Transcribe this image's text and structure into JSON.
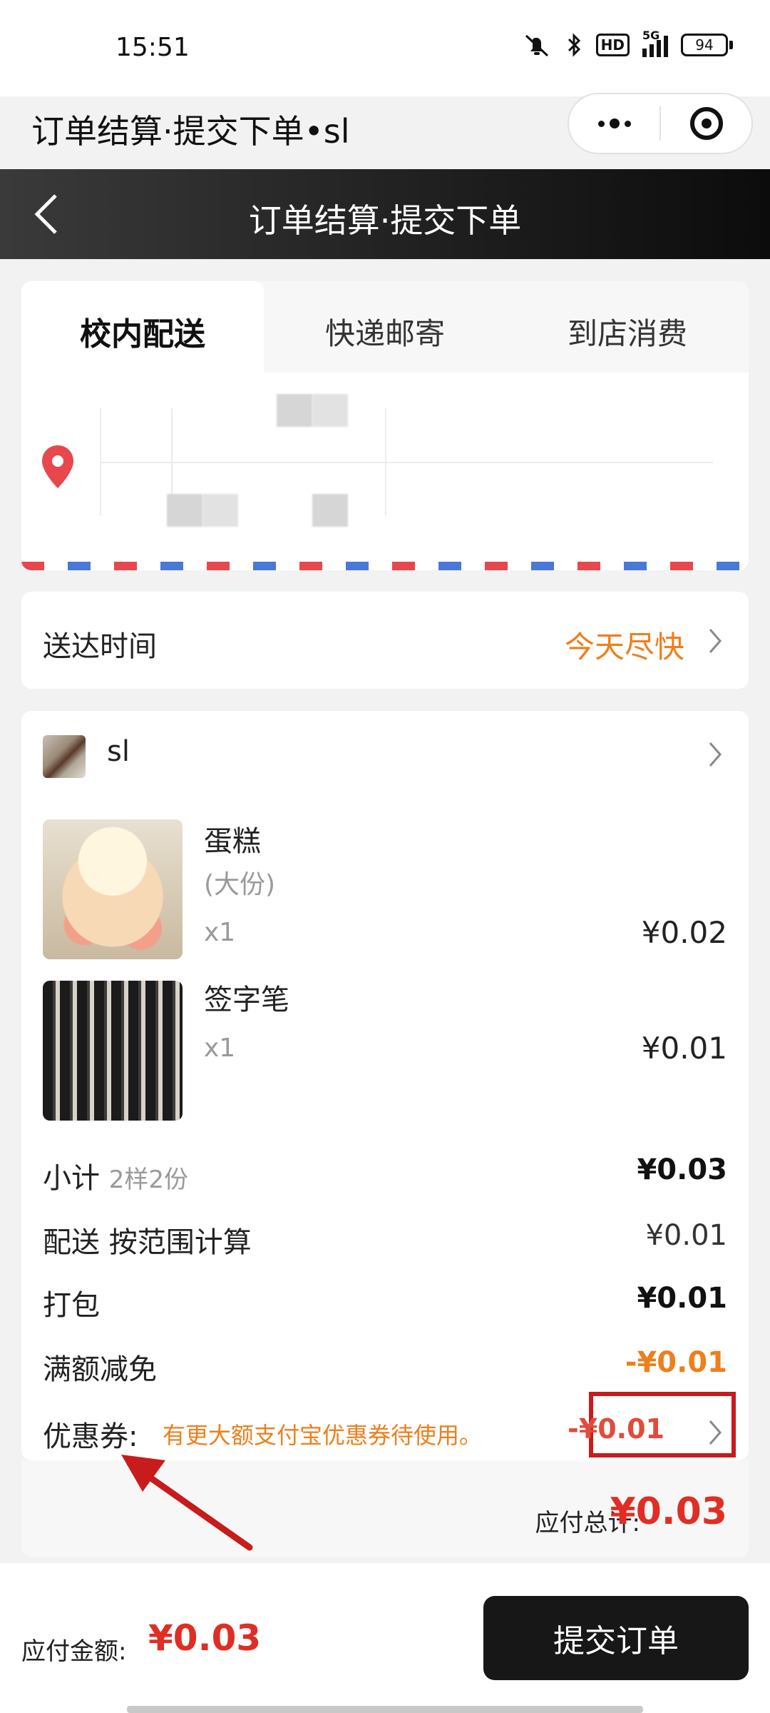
{
  "status_bar": {
    "time": "15:51",
    "hd": "HD",
    "network": "5G",
    "battery": "94"
  },
  "mini_program": {
    "title": "订单结算·提交下单•sl"
  },
  "navbar": {
    "title": "订单结算·提交下单"
  },
  "delivery_tabs": [
    {
      "label": "校内配送",
      "active": true
    },
    {
      "label": "快递邮寄",
      "active": false
    },
    {
      "label": "到店消费",
      "active": false
    }
  ],
  "delivery_time": {
    "label": "送达时间",
    "value": "今天尽快"
  },
  "shop": {
    "name": "sl"
  },
  "products": [
    {
      "name": "蛋糕",
      "spec": "(大份)",
      "qty": "x1",
      "price": "¥0.02"
    },
    {
      "name": "签字笔",
      "qty": "x1",
      "price": "¥0.01"
    }
  ],
  "fees": {
    "subtotal": {
      "label": "小计",
      "sub": "2样2份",
      "value": "¥0.03"
    },
    "delivery": {
      "label": "配送 按范围计算",
      "value": "¥0.01"
    },
    "packing": {
      "label": "打包",
      "value": "¥0.01"
    },
    "full_discount": {
      "label": "满额减免",
      "value": "-¥0.01"
    },
    "coupon": {
      "label": "优惠券:",
      "hint": "有更大额支付宝优惠券待使用。",
      "value": "-¥0.01"
    }
  },
  "total": {
    "label": "应付总计:",
    "value": "¥0.03"
  },
  "bottom_bar": {
    "pay_label": "应付金额:",
    "pay_value": "¥0.03",
    "submit_label": "提交订单"
  },
  "colors": {
    "accent_orange": "#ee7f1b",
    "price_red": "#e02e24",
    "highlight_box": "#c81b1b",
    "nav_dark": "#1e1e1e"
  }
}
